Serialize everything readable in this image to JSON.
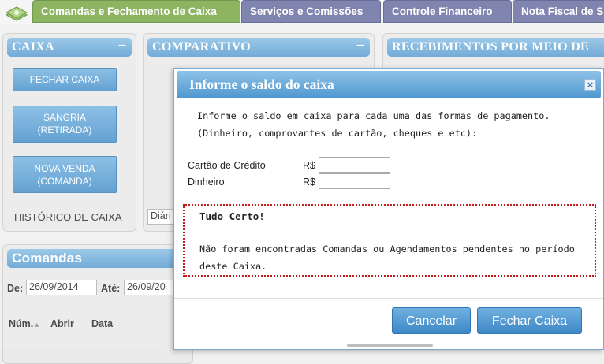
{
  "nav": {
    "tabs": [
      {
        "label": "Comandas e Fechamento de Caixa",
        "active": true
      },
      {
        "label": "Serviços e Comissões",
        "active": false
      },
      {
        "label": "Controle Financeiro",
        "active": false
      },
      {
        "label": "Nota Fiscal de S",
        "active": false
      }
    ]
  },
  "caixa": {
    "title": "CAIXA",
    "fechar_label": "FECHAR CAIXA",
    "sangria_line1": "SANGRIA",
    "sangria_line2": "(RETIRADA)",
    "nova_venda_line1": "NOVA VENDA",
    "nova_venda_line2": "(COMANDA)",
    "historico_label": "HISTÓRICO DE CAIXA"
  },
  "comparativo": {
    "title": "COMPARATIVO",
    "select_value": "Diári"
  },
  "recebimentos": {
    "title": "RECEBIMENTOS POR MEIO DE"
  },
  "comandas": {
    "title": "Comandas",
    "de_label": "De:",
    "de_value": "26/09/2014",
    "ate_label": "Até:",
    "ate_value": "26/09/20",
    "columns": [
      "Núm.",
      "Abrir",
      "Data"
    ]
  },
  "modal": {
    "title": "Informe o saldo do caixa",
    "close_glyph": "×",
    "instructions": "Informe o saldo em caixa para cada uma das formas de pagamento. (Dinheiro, comprovantes de cartão, cheques e etc):",
    "fields": [
      {
        "label": "Cartão de Crédito",
        "currency": "R$",
        "value": ""
      },
      {
        "label": "Dinheiro",
        "currency": "R$",
        "value": ""
      }
    ],
    "alert_title": "Tudo Certo!",
    "alert_message": "Não foram encontradas Comandas ou Agendamentos pendentes no período deste Caixa.",
    "cancel_label": "Cancelar",
    "confirm_label": "Fechar Caixa"
  },
  "colors": {
    "active_tab": "#7daa4c",
    "inactive_tab": "#6f75a6",
    "header_blue": "#5fa0d2",
    "alert_border": "#c21b1b"
  }
}
